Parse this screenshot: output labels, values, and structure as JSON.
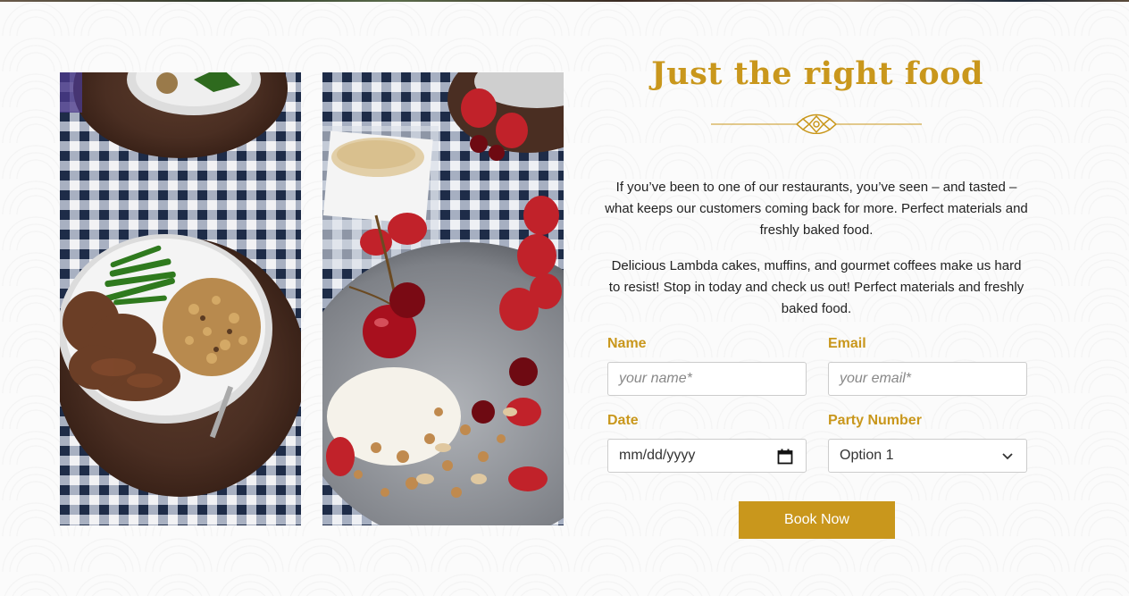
{
  "section": {
    "title": "Just the right food",
    "paragraph_1": "If you’ve been to one of our restaurants, you’ve seen – and tasted – what keeps our customers coming back for more. Perfect materials and freshly baked food.",
    "paragraph_2": "Delicious Lambda cakes, muffins, and gourmet coffees make us hard to resist! Stop in today and check us out! Perfect materials and freshly baked food."
  },
  "images": {
    "left": "plate-with-meat-and-beans-photo",
    "right": "cherry-yogurt-granola-photo"
  },
  "form": {
    "name_label": "Name",
    "name_placeholder": "your name*",
    "email_label": "Email",
    "email_placeholder": "your email*",
    "date_label": "Date",
    "date_placeholder": "mm/dd/yyyy",
    "party_label": "Party Number",
    "party_selected": "Option 1",
    "submit_label": "Book Now"
  },
  "colors": {
    "accent": "#c9971c",
    "text": "#222222",
    "field_border": "#cccccc"
  },
  "icons": {
    "date": "calendar-icon",
    "select": "chevron-down-icon",
    "divider": "ornament-divider-icon"
  }
}
